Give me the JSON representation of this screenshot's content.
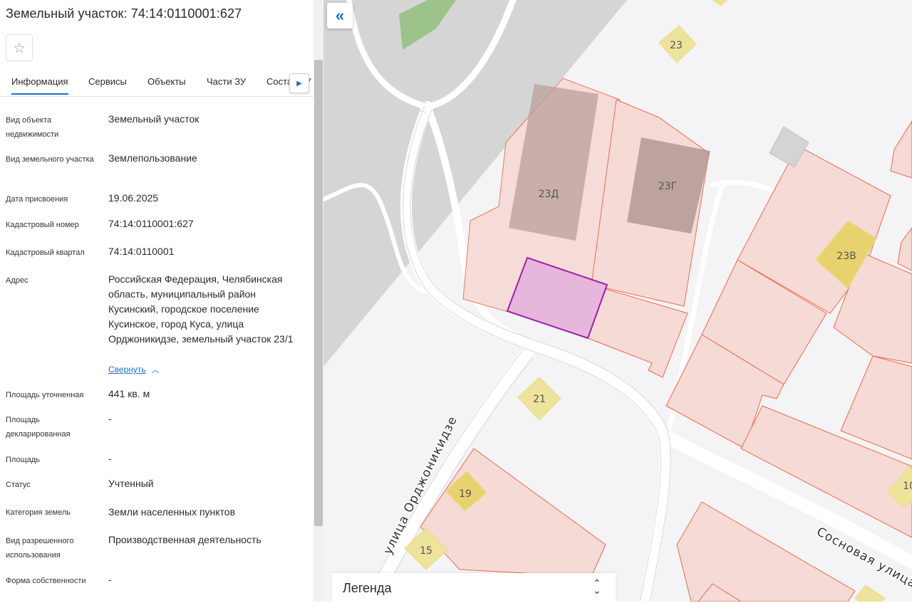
{
  "panel": {
    "title": "Земельный участок: 74:14:0110001:627",
    "favorite_icon": "star-outline-icon",
    "tabs": [
      "Информация",
      "Сервисы",
      "Объекты",
      "Части ЗУ",
      "Состав ЗУ"
    ],
    "active_tab": "Информация",
    "fields": [
      {
        "label": "Вид объекта недвижимости",
        "value": "Земельный участок"
      },
      {
        "label": "Вид земельного участка",
        "value": "Землепользование"
      },
      {
        "label": "Дата присвоения",
        "value": "19.06.2025"
      },
      {
        "label": "Кадастровый номер",
        "value": "74:14:0110001:627"
      },
      {
        "label": "Кадастровый квартал",
        "value": "74:14:0110001"
      },
      {
        "label": "Адрес",
        "value": "Российская Федерация, Челябинская область, муниципальный район Кусинский, городское поселение Кусинское, город Куса, улица Орджоникидзе, земельный участок 23/1"
      },
      {
        "label": "Площадь уточненная",
        "value": "441 кв. м"
      },
      {
        "label": "Площадь декларированная",
        "value": "-"
      },
      {
        "label": "Площадь",
        "value": "-"
      },
      {
        "label": "Статус",
        "value": "Учтенный"
      },
      {
        "label": "Категория земель",
        "value": "Земли населенных пунктов"
      },
      {
        "label": "Вид разрешенного использования",
        "value": "Производственная деятельность"
      },
      {
        "label": "Форма собственности",
        "value": "-"
      }
    ],
    "collapse_link": "Свернуть"
  },
  "map": {
    "collapse_button_icon": "double-chevron-left-icon",
    "building_labels": [
      "23",
      "23Д",
      "23Г",
      "23В",
      "21",
      "19",
      "15",
      "10"
    ],
    "street_labels": [
      "улица Орджоникидзе",
      "Сосновая улица"
    ],
    "legend_label": "Легенда",
    "legend_icon": "chevron-updown-icon",
    "colors": {
      "parcel_fill": "#f6dad6",
      "parcel_stroke": "#ee6a4a",
      "selected_fill": "#e6b6dc",
      "selected_stroke": "#a020a8",
      "building_fill": "#c4aaa4",
      "house_marker": "#eee39a",
      "road": "#ffffff",
      "forest": "#9cc38a",
      "shaded_area": "#cfcfcf"
    }
  }
}
